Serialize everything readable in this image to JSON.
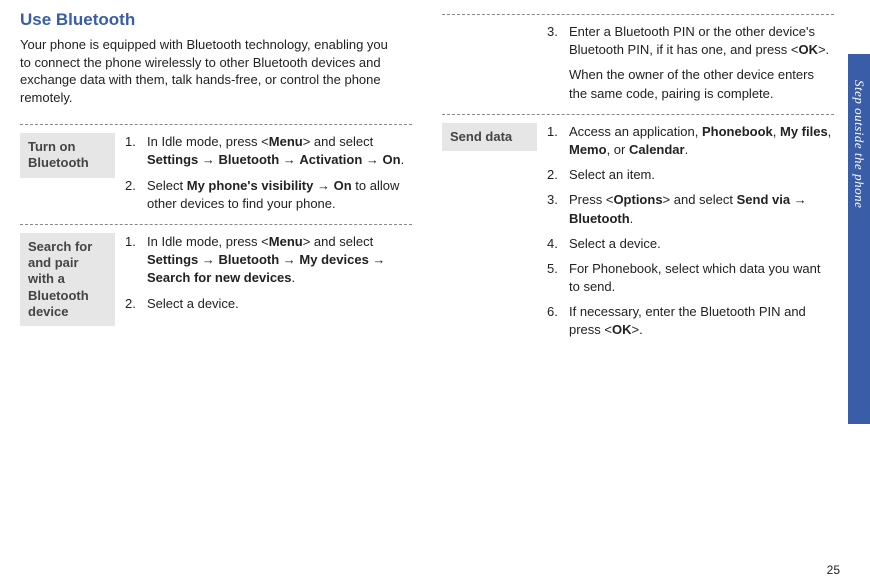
{
  "heading": "Use Bluetooth",
  "intro": "Your phone is equipped with Bluetooth technology, enabling you to connect the phone wirelessly to other Bluetooth devices and exchange data with them, talk hands-free, or control the phone remotely.",
  "sideTab": "Step outside the phone",
  "pageNumber": "25",
  "sections": {
    "turnOn": {
      "label": "Turn on Bluetooth",
      "steps": [
        {
          "num": "1.",
          "parts": [
            "In Idle mode, press <",
            "Menu",
            "> and select ",
            "Settings",
            " → ",
            "Bluetooth",
            " → ",
            "Activation",
            " → ",
            "On",
            "."
          ]
        },
        {
          "num": "2.",
          "parts": [
            "Select ",
            "My phone's visibility",
            " → ",
            "On",
            " to allow other devices to find your phone."
          ]
        }
      ]
    },
    "search": {
      "label": "Search for and pair with a Bluetooth device",
      "steps": [
        {
          "num": "1.",
          "parts": [
            "In Idle mode, press <",
            "Menu",
            "> and select ",
            "Settings",
            " → ",
            "Bluetooth",
            " → ",
            "My devices",
            " → ",
            "Search for new devices",
            "."
          ]
        },
        {
          "num": "2.",
          "parts": [
            "Select a device."
          ]
        },
        {
          "num": "3.",
          "parts": [
            "Enter a Bluetooth PIN or the other device's Bluetooth PIN, if it has one, and press <",
            "OK",
            ">."
          ],
          "extra": "When the owner of the other device enters the same code, pairing is complete."
        }
      ]
    },
    "sendData": {
      "label": "Send data",
      "steps": [
        {
          "num": "1.",
          "parts": [
            "Access an application, ",
            "Phonebook",
            ", ",
            "My files",
            ", ",
            "Memo",
            ", or ",
            "Calendar",
            "."
          ]
        },
        {
          "num": "2.",
          "parts": [
            "Select an item."
          ]
        },
        {
          "num": "3.",
          "parts": [
            "Press <",
            "Options",
            "> and select ",
            "Send via",
            " → ",
            "Bluetooth",
            "."
          ]
        },
        {
          "num": "4.",
          "parts": [
            "Select a device."
          ]
        },
        {
          "num": "5.",
          "parts": [
            "For Phonebook, select which data you want to send."
          ]
        },
        {
          "num": "6.",
          "parts": [
            "If necessary, enter the Bluetooth PIN and press <",
            "OK",
            ">."
          ]
        }
      ]
    }
  }
}
